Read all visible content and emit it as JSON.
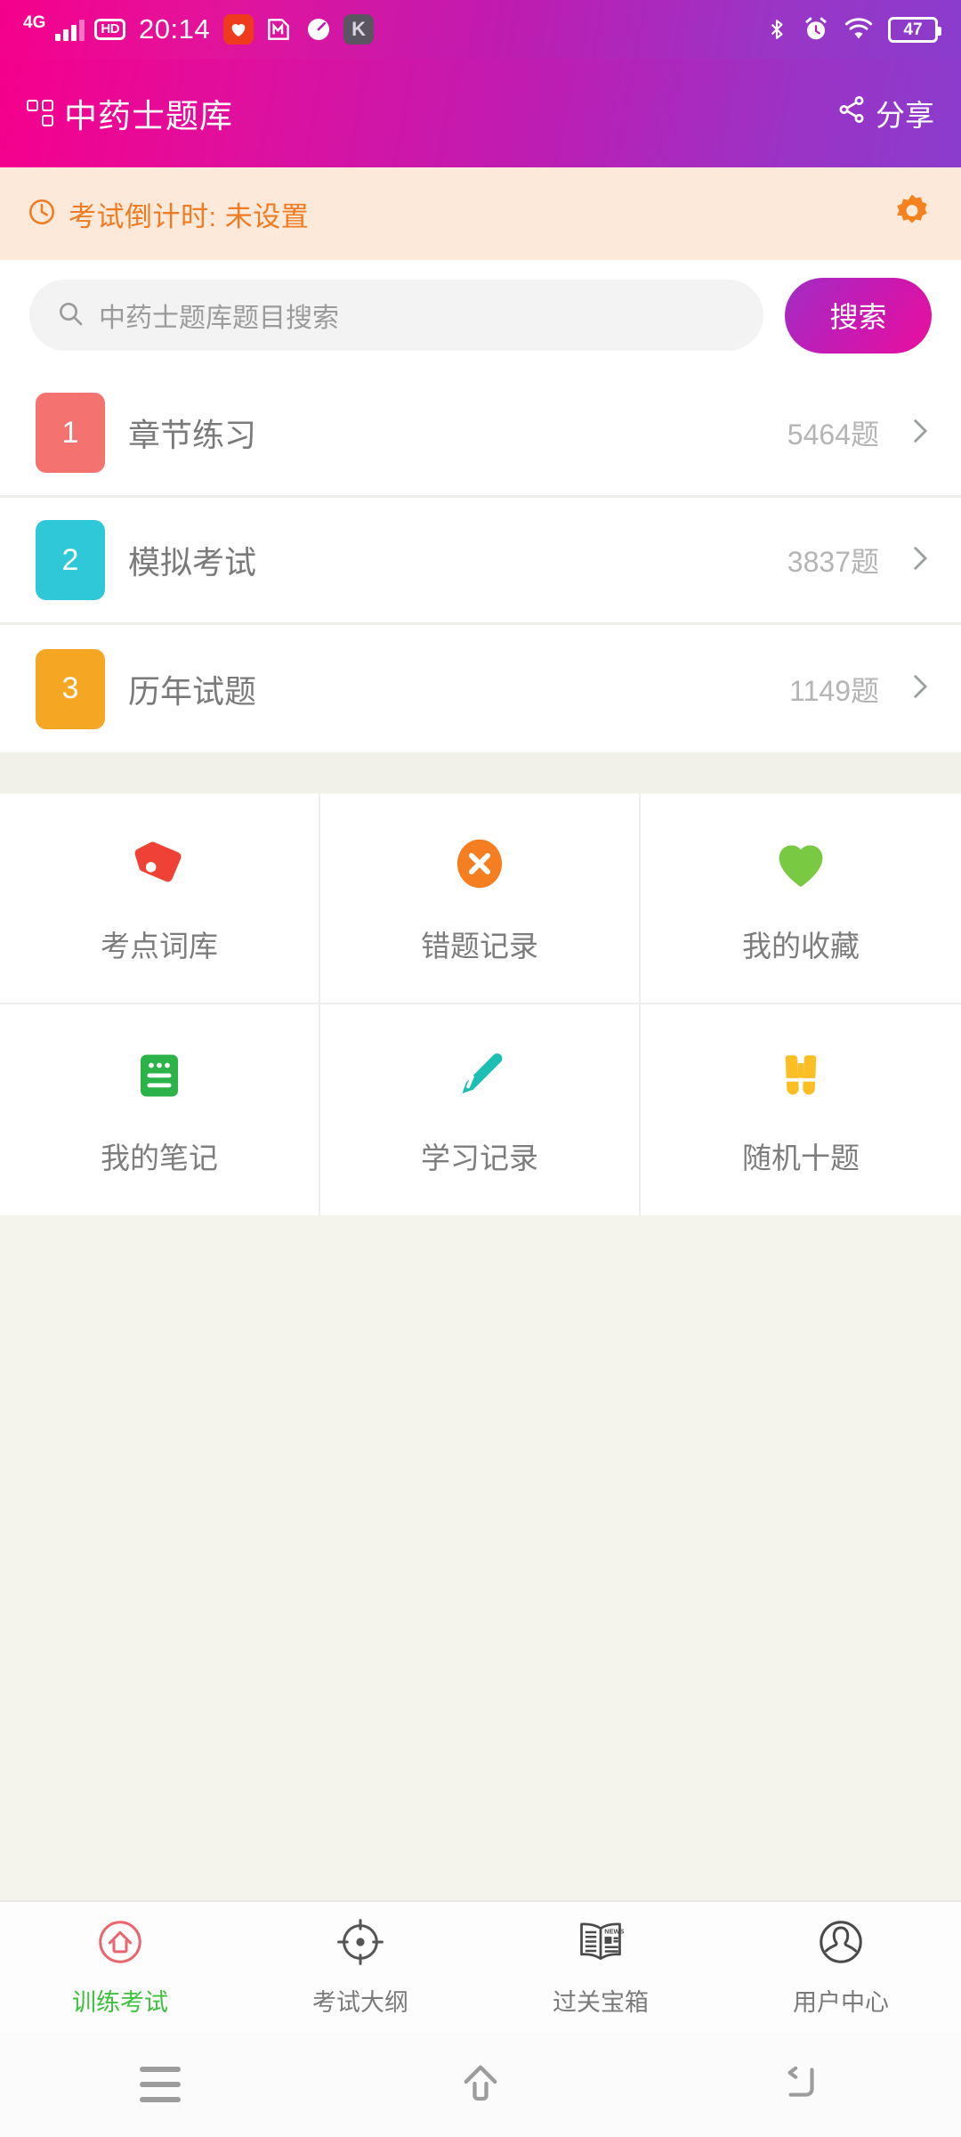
{
  "status_bar": {
    "network_type": "4G",
    "hd_label": "HD",
    "time": "20:14",
    "battery_percent": "47",
    "icons": [
      "signal-bars-icon",
      "hd-icon",
      "heart-app-icon",
      "m-app-icon",
      "meter-app-icon",
      "k-app-icon",
      "bluetooth-icon",
      "alarm-icon",
      "wifi-icon",
      "battery-icon"
    ]
  },
  "header": {
    "title": "中药士题库",
    "logo_icon": "grid-logo-icon",
    "share_label": "分享",
    "share_icon": "share-icon",
    "gradient_start": "#f5008c",
    "gradient_end": "#8b3ccc"
  },
  "countdown": {
    "clock_icon": "clock-icon",
    "text": "考试倒计时: 未设置",
    "settings_icon": "gear-icon",
    "background": "#fde9d9",
    "text_color": "#ef7c23"
  },
  "search": {
    "icon": "search-icon",
    "placeholder": "中药士题库题目搜索",
    "value": "",
    "button_label": "搜索"
  },
  "list": {
    "rows": [
      {
        "number": "1",
        "label": "章节练习",
        "count": "5464题",
        "color": "#f4726f",
        "chevron": "chevron-right-icon"
      },
      {
        "number": "2",
        "label": "模拟考试",
        "count": "3837题",
        "color": "#2ec8d8",
        "chevron": "chevron-right-icon"
      },
      {
        "number": "3",
        "label": "历年试题",
        "count": "1149题",
        "color": "#f5a623",
        "chevron": "chevron-right-icon"
      }
    ]
  },
  "tiles": [
    {
      "label": "考点词库",
      "icon": "tag-icon",
      "color": "#ef4136"
    },
    {
      "label": "错题记录",
      "icon": "x-circle-icon",
      "color": "#f57f20"
    },
    {
      "label": "我的收藏",
      "icon": "heart-icon",
      "color": "#7ac943"
    },
    {
      "label": "我的笔记",
      "icon": "notepad-icon",
      "color": "#2bb34a"
    },
    {
      "label": "学习记录",
      "icon": "pencil-icon",
      "color": "#1dbfb5"
    },
    {
      "label": "随机十题",
      "icon": "binoculars-icon",
      "color": "#fbbf24"
    }
  ],
  "tabbar": {
    "items": [
      {
        "label": "训练考试",
        "icon": "home-circle-icon",
        "active": true,
        "color": "#3fc03f"
      },
      {
        "label": "考试大纲",
        "icon": "target-icon",
        "active": false,
        "color": "#7a7a7a"
      },
      {
        "label": "过关宝箱",
        "icon": "newspaper-icon",
        "active": false,
        "color": "#7a7a7a"
      },
      {
        "label": "用户中心",
        "icon": "user-circle-icon",
        "active": false,
        "color": "#7a7a7a"
      }
    ]
  },
  "android_nav": {
    "buttons": [
      "recents-icon",
      "home-icon",
      "back-icon"
    ]
  }
}
